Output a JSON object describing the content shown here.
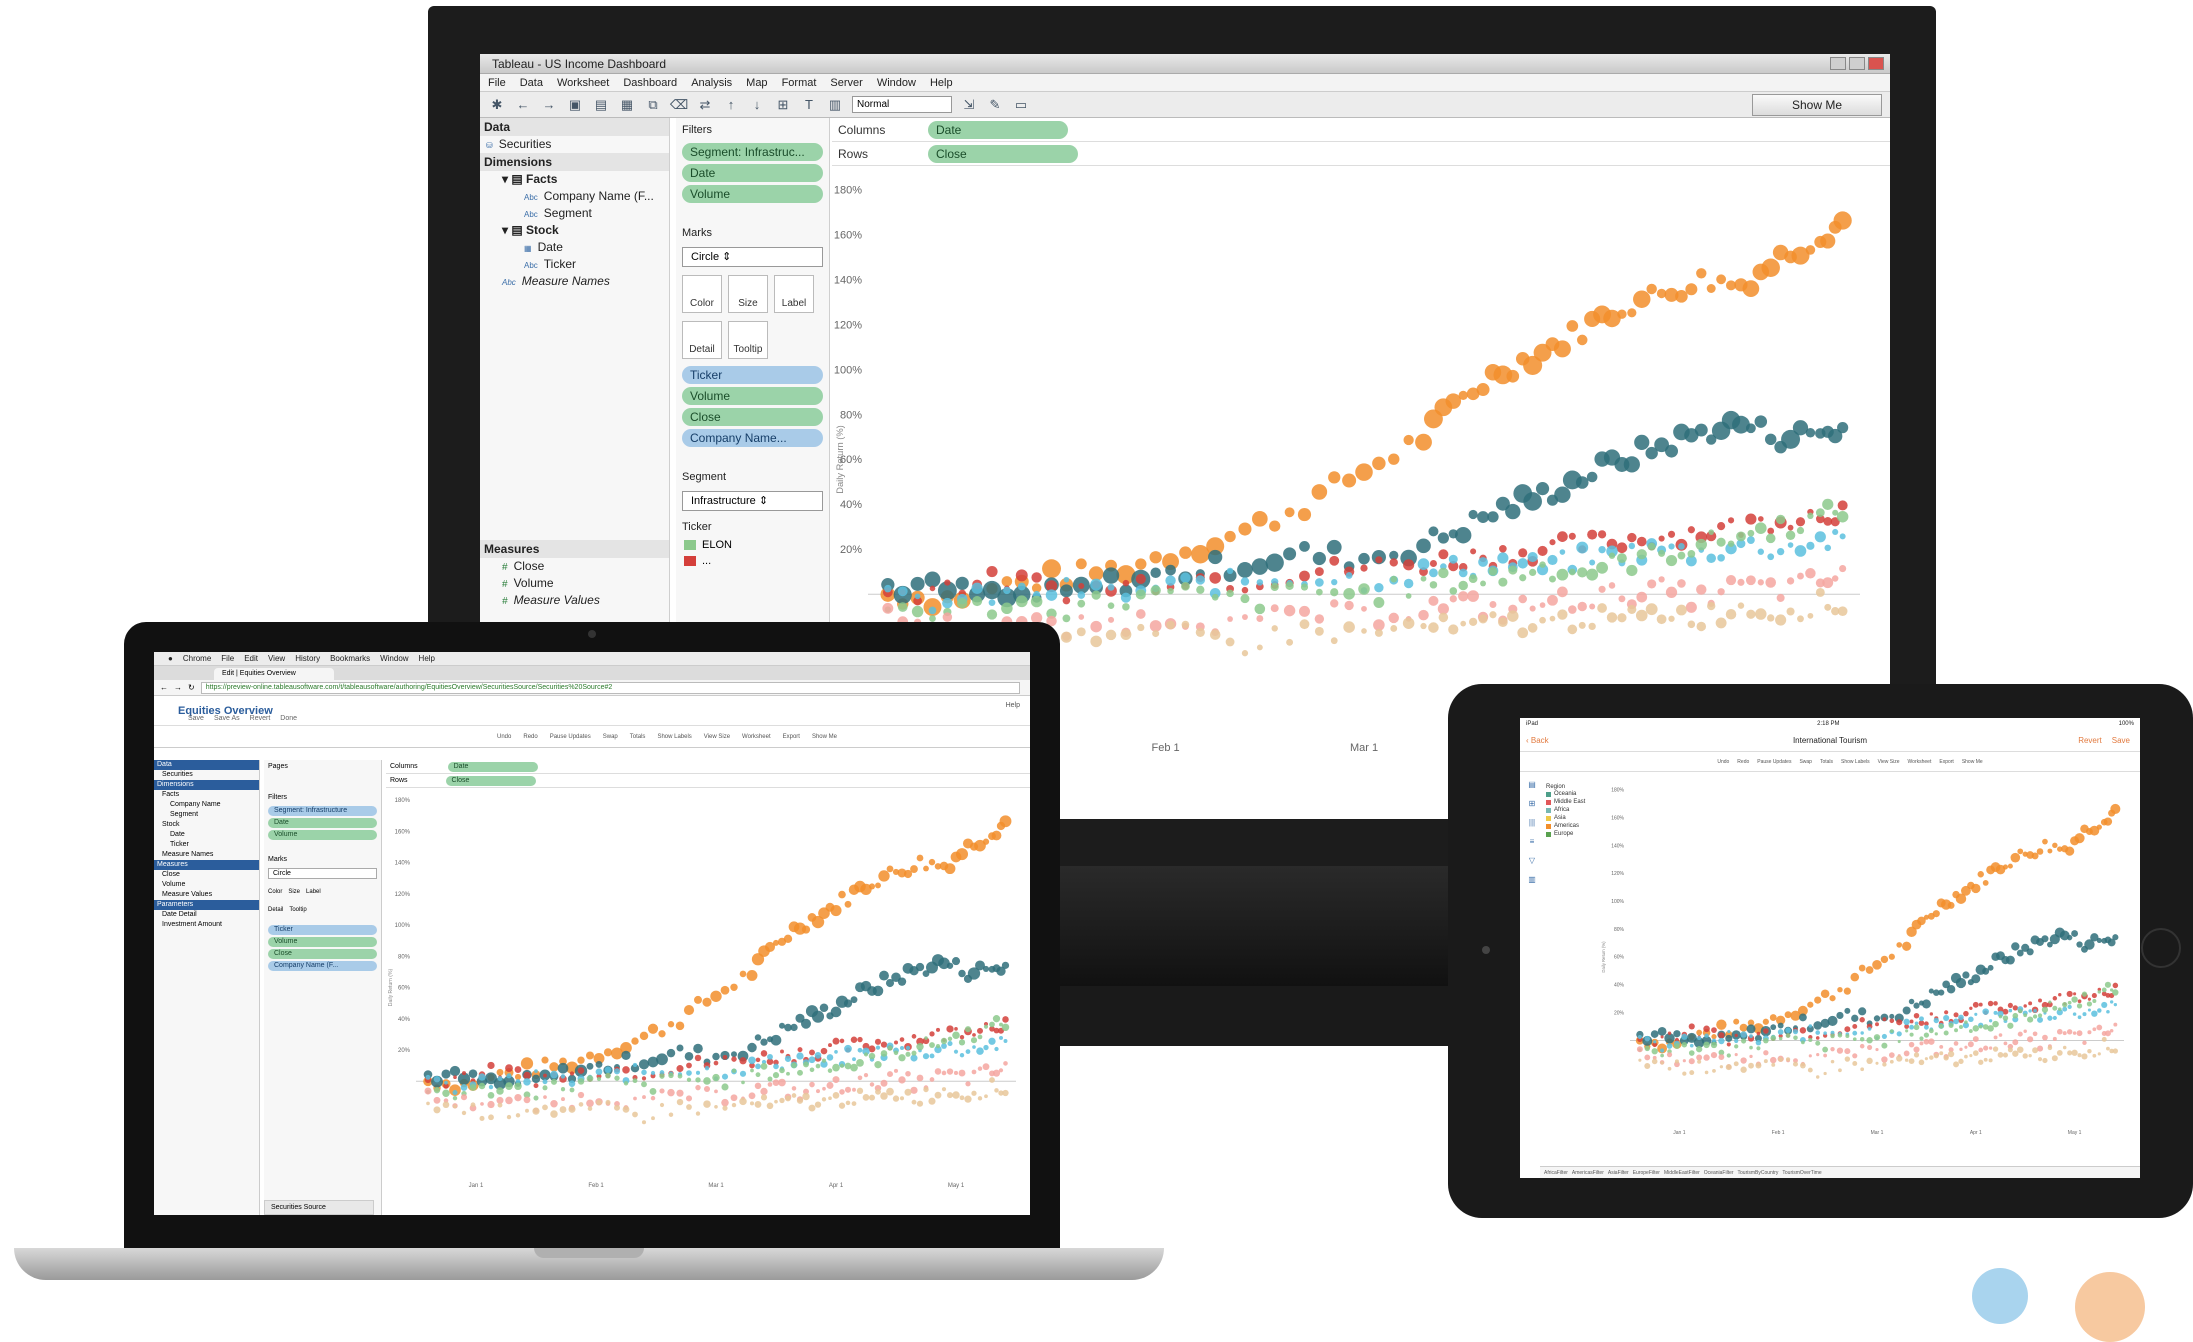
{
  "monitor": {
    "window_title": "Tableau - US Income Dashboard",
    "menu": [
      "File",
      "Data",
      "Worksheet",
      "Dashboard",
      "Analysis",
      "Map",
      "Format",
      "Server",
      "Window",
      "Help"
    ],
    "fit_select": "Normal",
    "show_me": "Show Me",
    "data_pane": {
      "header": "Data",
      "source": "Securities",
      "dimensions_label": "Dimensions",
      "dimensions": [
        {
          "label": "Facts",
          "level": 1,
          "bold": true
        },
        {
          "label": "Company Name (F...",
          "level": 2
        },
        {
          "label": "Segment",
          "level": 2
        },
        {
          "label": "Stock",
          "level": 1,
          "bold": true
        },
        {
          "label": "Date",
          "level": 2
        },
        {
          "label": "Ticker",
          "level": 2
        },
        {
          "label": "Measure Names",
          "level": 1,
          "italic": true
        }
      ],
      "measures_label": "Measures",
      "measures": [
        "Close",
        "Volume",
        "Measure Values"
      ]
    },
    "filters_label": "Filters",
    "filters": [
      "Segment: Infrastruc...",
      "Date",
      "Volume"
    ],
    "marks_label": "Marks",
    "marks_type": "Circle",
    "mark_buttons": [
      "Color",
      "Size",
      "Label",
      "Detail",
      "Tooltip"
    ],
    "mark_pills": [
      "Ticker",
      "Volume",
      "Close",
      "Company Name..."
    ],
    "segment_label": "Segment",
    "segment_value": "Infrastructure",
    "ticker_label": "Ticker",
    "ticker_items": [
      "ELON",
      "..."
    ],
    "columns_label": "Columns",
    "columns_pill": "Date",
    "rows_label": "Rows",
    "rows_pill": "Close",
    "y_axis_label": "Daily Return (%)"
  },
  "laptop": {
    "mac_menu": [
      "Chrome",
      "File",
      "Edit",
      "View",
      "History",
      "Bookmarks",
      "Window",
      "Help"
    ],
    "tab_title": "Edit | Equities Overview",
    "url": "https://preview-online.tableausoftware.com/t/tableausoftware/authoring/EquitiesOverview/SecuritiesSource/Securities%20Source#2",
    "title": "Equities Overview",
    "sub_actions": [
      "Save",
      "Save As",
      "Revert",
      "Done"
    ],
    "help": "Help",
    "toolbar": [
      "Undo",
      "Redo",
      "Pause Updates",
      "Swap",
      "Totals",
      "Show Labels",
      "View Size",
      "Worksheet",
      "Export",
      "Show Me"
    ],
    "data_header": "Data",
    "source": "Securities",
    "dimensions_header": "Dimensions",
    "dimensions": [
      "Facts",
      "Company Name",
      "Segment",
      "Stock",
      "Date",
      "Ticker",
      "Measure Names"
    ],
    "measures_header": "Measures",
    "measures": [
      "Close",
      "Volume",
      "Measure Values"
    ],
    "parameters_header": "Parameters",
    "parameters": [
      "Date Detail",
      "Investment Amount"
    ],
    "pages_label": "Pages",
    "filters_label": "Filters",
    "filters": [
      "Segment: Infrastructure",
      "Date",
      "Volume"
    ],
    "marks_label": "Marks",
    "marks_type": "Circle",
    "mark_buttons": [
      "Color",
      "Size",
      "Label",
      "Detail",
      "Tooltip"
    ],
    "mark_pills": [
      "Ticker",
      "Volume",
      "Close",
      "Company Name (F..."
    ],
    "columns_label": "Columns",
    "columns_pill": "Date",
    "rows_label": "Rows",
    "rows_pill": "Close",
    "sheet_tab": "Securities Source",
    "y_axis_label": "Daily Return (%)"
  },
  "tablet": {
    "status_left": "iPad",
    "status_time": "2:18 PM",
    "status_right": "100%",
    "back": "Back",
    "title": "International Tourism",
    "actions": [
      "Revert",
      "Save"
    ],
    "toolbar": [
      "Undo",
      "Redo",
      "Pause Updates",
      "Swap",
      "Totals",
      "Show Labels",
      "View Size",
      "Worksheet",
      "Export",
      "Show Me"
    ],
    "legend_title": "Region",
    "legend": [
      {
        "label": "Oceania",
        "color": "#4e9f8a"
      },
      {
        "label": "Middle East",
        "color": "#e15759"
      },
      {
        "label": "Africa",
        "color": "#76b7b2"
      },
      {
        "label": "Asia",
        "color": "#edc948"
      },
      {
        "label": "Americas",
        "color": "#f28e2b"
      },
      {
        "label": "Europe",
        "color": "#59a14f"
      }
    ],
    "sheet_tabs": [
      "AfricaFilter",
      "AmericasFilter",
      "AsiaFilter",
      "EuropeFilter",
      "MiddleEastFilter",
      "OceaniaFilter",
      "TourismByCountry",
      "TourismOverTime"
    ],
    "y_axis_label": "Daily Return (%)"
  },
  "chart_data": {
    "type": "scatter",
    "title": "",
    "xlabel": "",
    "ylabel": "Daily Return (%)",
    "x_ticks": [
      "Jan 1",
      "Feb 1",
      "Mar 1",
      "Apr 1",
      "May 1"
    ],
    "y_ticks": [
      "180%",
      "160%",
      "140%",
      "120%",
      "100%",
      "80%",
      "60%",
      "40%",
      "20%"
    ],
    "ylim": [
      -60,
      180
    ],
    "x_range": [
      0,
      100
    ],
    "series": [
      {
        "name": "orange",
        "color": "#f28e2b",
        "points": [
          [
            2,
            0
          ],
          [
            8,
            -2
          ],
          [
            14,
            4
          ],
          [
            20,
            8
          ],
          [
            26,
            12
          ],
          [
            32,
            20
          ],
          [
            38,
            28
          ],
          [
            44,
            40
          ],
          [
            50,
            55
          ],
          [
            56,
            70
          ],
          [
            60,
            88
          ],
          [
            64,
            100
          ],
          [
            68,
            108
          ],
          [
            72,
            118
          ],
          [
            76,
            128
          ],
          [
            80,
            134
          ],
          [
            84,
            140
          ],
          [
            88,
            138
          ],
          [
            92,
            150
          ],
          [
            96,
            160
          ],
          [
            99,
            168
          ]
        ]
      },
      {
        "name": "teal",
        "color": "#2f6f7a",
        "points": [
          [
            2,
            4
          ],
          [
            8,
            2
          ],
          [
            14,
            -2
          ],
          [
            20,
            0
          ],
          [
            26,
            6
          ],
          [
            32,
            10
          ],
          [
            38,
            14
          ],
          [
            44,
            18
          ],
          [
            50,
            16
          ],
          [
            56,
            22
          ],
          [
            60,
            30
          ],
          [
            64,
            38
          ],
          [
            68,
            44
          ],
          [
            72,
            52
          ],
          [
            76,
            60
          ],
          [
            80,
            66
          ],
          [
            84,
            72
          ],
          [
            88,
            76
          ],
          [
            92,
            70
          ],
          [
            96,
            72
          ],
          [
            99,
            74
          ]
        ]
      },
      {
        "name": "red",
        "color": "#d43f3a",
        "points": [
          [
            2,
            0
          ],
          [
            8,
            4
          ],
          [
            14,
            6
          ],
          [
            20,
            2
          ],
          [
            26,
            4
          ],
          [
            32,
            8
          ],
          [
            38,
            6
          ],
          [
            44,
            10
          ],
          [
            50,
            12
          ],
          [
            56,
            14
          ],
          [
            60,
            16
          ],
          [
            64,
            18
          ],
          [
            68,
            20
          ],
          [
            72,
            22
          ],
          [
            76,
            24
          ],
          [
            80,
            26
          ],
          [
            84,
            28
          ],
          [
            88,
            30
          ],
          [
            92,
            34
          ],
          [
            96,
            36
          ],
          [
            99,
            38
          ]
        ]
      },
      {
        "name": "cyan",
        "color": "#5bc0de",
        "points": [
          [
            2,
            -2
          ],
          [
            8,
            -4
          ],
          [
            14,
            0
          ],
          [
            20,
            2
          ],
          [
            26,
            0
          ],
          [
            32,
            4
          ],
          [
            38,
            6
          ],
          [
            44,
            8
          ],
          [
            50,
            6
          ],
          [
            56,
            10
          ],
          [
            60,
            12
          ],
          [
            64,
            14
          ],
          [
            68,
            12
          ],
          [
            72,
            16
          ],
          [
            76,
            18
          ],
          [
            80,
            20
          ],
          [
            84,
            18
          ],
          [
            88,
            22
          ],
          [
            92,
            20
          ],
          [
            96,
            24
          ],
          [
            99,
            22
          ]
        ]
      },
      {
        "name": "green",
        "color": "#8cc98c",
        "points": [
          [
            2,
            -6
          ],
          [
            8,
            -8
          ],
          [
            14,
            -4
          ],
          [
            20,
            -6
          ],
          [
            26,
            -2
          ],
          [
            32,
            0
          ],
          [
            38,
            -4
          ],
          [
            44,
            2
          ],
          [
            50,
            0
          ],
          [
            56,
            4
          ],
          [
            60,
            6
          ],
          [
            64,
            8
          ],
          [
            68,
            12
          ],
          [
            72,
            10
          ],
          [
            76,
            14
          ],
          [
            80,
            18
          ],
          [
            84,
            22
          ],
          [
            88,
            26
          ],
          [
            92,
            30
          ],
          [
            96,
            34
          ],
          [
            99,
            40
          ]
        ]
      },
      {
        "name": "pink",
        "color": "#f4a6a0",
        "points": [
          [
            2,
            -10
          ],
          [
            8,
            -14
          ],
          [
            14,
            -12
          ],
          [
            20,
            -16
          ],
          [
            26,
            -12
          ],
          [
            32,
            -10
          ],
          [
            38,
            -14
          ],
          [
            44,
            -8
          ],
          [
            50,
            -10
          ],
          [
            56,
            -6
          ],
          [
            60,
            -4
          ],
          [
            64,
            -8
          ],
          [
            68,
            -4
          ],
          [
            72,
            -2
          ],
          [
            76,
            0
          ],
          [
            80,
            2
          ],
          [
            84,
            -2
          ],
          [
            88,
            4
          ],
          [
            92,
            2
          ],
          [
            96,
            6
          ],
          [
            99,
            8
          ]
        ]
      },
      {
        "name": "tan",
        "color": "#e8c79a",
        "points": [
          [
            2,
            -14
          ],
          [
            8,
            -18
          ],
          [
            14,
            -20
          ],
          [
            20,
            -16
          ],
          [
            26,
            -20
          ],
          [
            32,
            -18
          ],
          [
            38,
            -22
          ],
          [
            44,
            -16
          ],
          [
            50,
            -18
          ],
          [
            56,
            -14
          ],
          [
            60,
            -16
          ],
          [
            64,
            -12
          ],
          [
            68,
            -14
          ],
          [
            72,
            -10
          ],
          [
            76,
            -12
          ],
          [
            80,
            -8
          ],
          [
            84,
            -10
          ],
          [
            88,
            -6
          ],
          [
            92,
            -8
          ],
          [
            96,
            -4
          ],
          [
            99,
            -6
          ]
        ]
      }
    ]
  }
}
